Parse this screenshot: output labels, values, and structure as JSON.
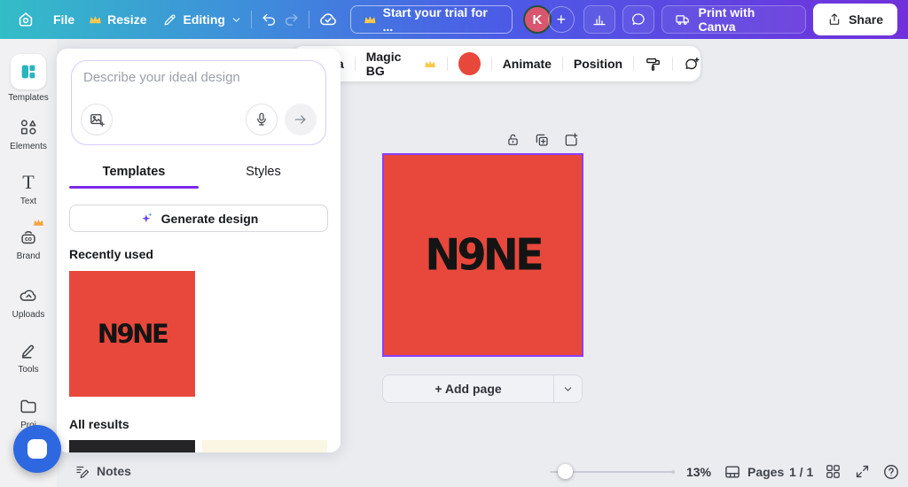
{
  "topbar": {
    "file": "File",
    "resize": "Resize",
    "editing": "Editing",
    "trial_button": "Start your trial for ...",
    "avatar_initial": "K",
    "print_button": "Print with Canva",
    "share_button": "Share"
  },
  "sidebar": {
    "items": [
      {
        "label": "Templates",
        "icon": "templates-icon",
        "active": true
      },
      {
        "label": "Elements",
        "icon": "elements-icon"
      },
      {
        "label": "Text",
        "icon": "text-icon"
      },
      {
        "label": "Brand",
        "icon": "brand-icon",
        "pro": true
      },
      {
        "label": "Uploads",
        "icon": "uploads-icon"
      },
      {
        "label": "Tools",
        "icon": "tools-icon"
      },
      {
        "label": "Proj",
        "icon": "projects-icon"
      }
    ]
  },
  "panel": {
    "prompt_placeholder": "Describe your ideal design",
    "tabs": [
      {
        "label": "Templates"
      },
      {
        "label": "Styles"
      }
    ],
    "generate_button": "Generate design",
    "recently_used_heading": "Recently used",
    "all_results_heading": "All results",
    "recent_thumb_text": "N9NE"
  },
  "context_toolbar": {
    "partial_label": "a",
    "magic_bg": "Magic BG",
    "animate": "Animate",
    "position": "Position"
  },
  "canvas": {
    "logo_text": "N9NE",
    "add_page_button": "+ Add page"
  },
  "statusbar": {
    "notes": "Notes",
    "zoom_percent": "13%",
    "pages_label": "Pages",
    "page_indicator": "1 / 1"
  },
  "colors": {
    "page_red": "#E8483C",
    "selection_purple": "#8B3DFF",
    "tab_accent_purple": "#7D2AE8",
    "chat_bubble_blue": "#2E68E0",
    "sidebar_active_teal": "#2AB4BE",
    "crown_gold": "#FFC94D",
    "brand_crown_orange": "#F2A33C",
    "sliver_dark": "#242426",
    "sliver_cream": "#FAF6E3"
  }
}
